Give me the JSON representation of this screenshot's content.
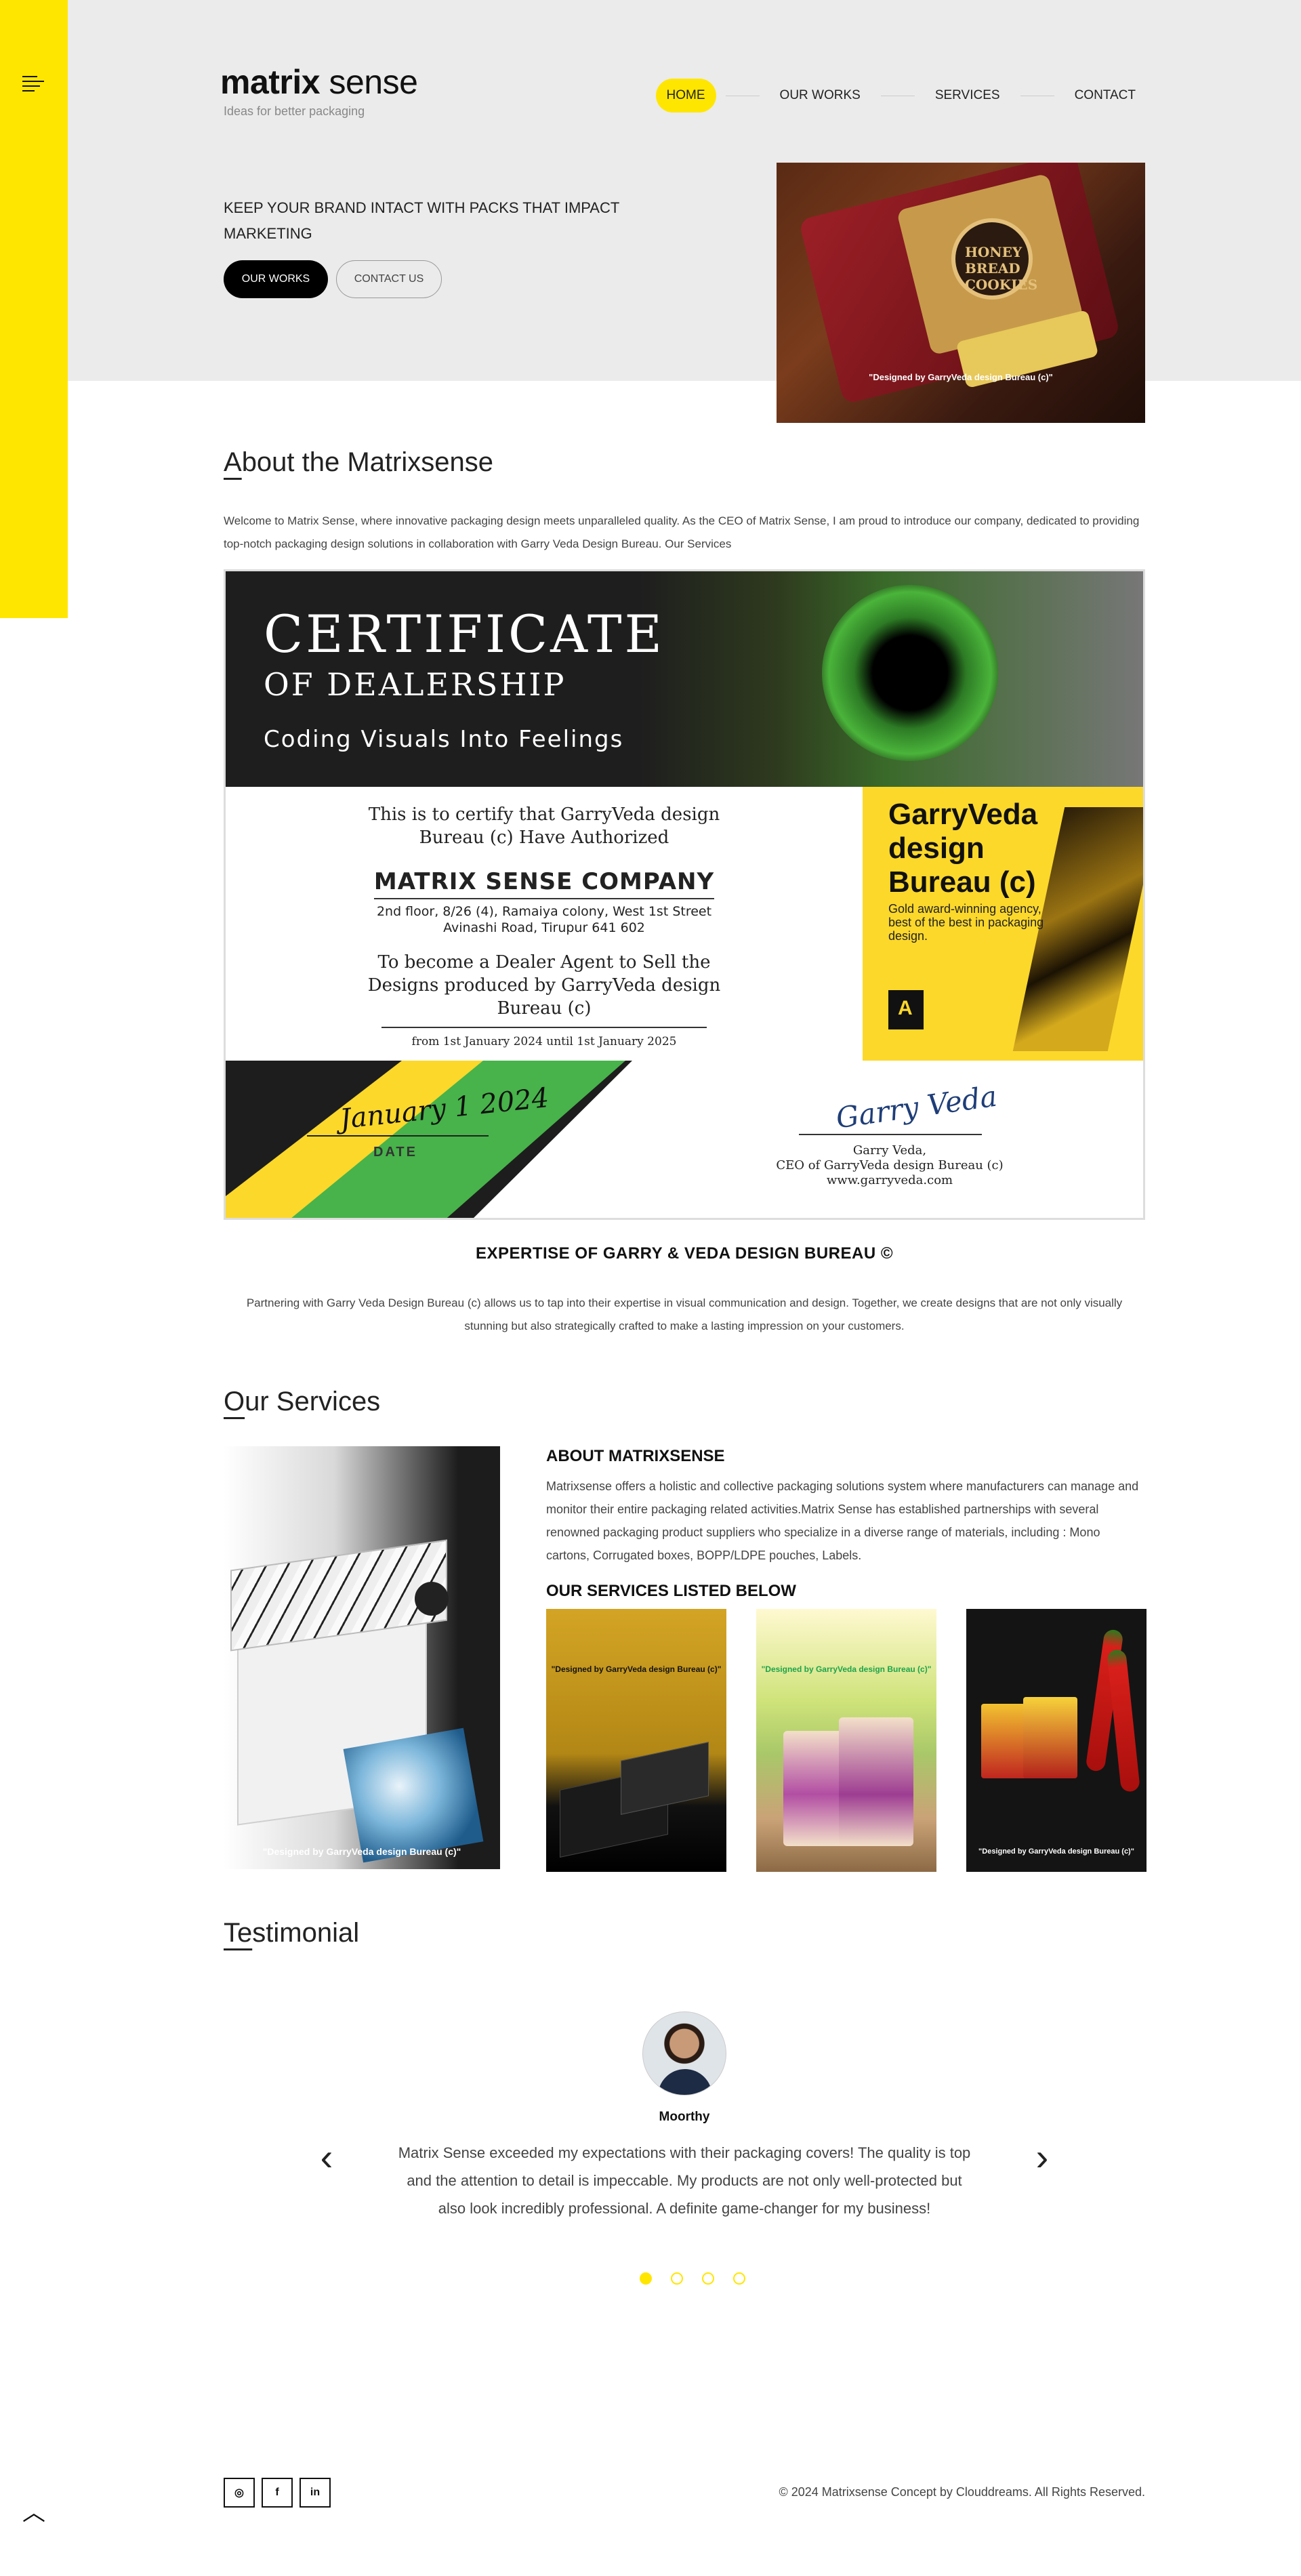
{
  "brand": {
    "name_bold": "matrix",
    "name_light": " sense",
    "tagline": "Ideas for better packaging"
  },
  "nav": {
    "items": [
      {
        "label": "HOME",
        "active": true
      },
      {
        "label": "OUR WORKS",
        "active": false
      },
      {
        "label": "SERVICES",
        "active": false
      },
      {
        "label": "CONTACT",
        "active": false
      }
    ]
  },
  "hero": {
    "headline": "KEEP YOUR BRAND INTACT WITH PACKS THAT IMPACT MARKETING",
    "primary_button": "OUR WORKS",
    "secondary_button": "CONTACT US",
    "image_seal": "HONEY BREAD COOKIES",
    "image_caption": "\"Designed by GarryVeda design Bureau (c)\""
  },
  "about": {
    "title_first": "A",
    "title_rest": "bout the Matrixsense",
    "text": "Welcome to Matrix Sense, where innovative packaging design meets unparalleled quality. As the CEO of Matrix Sense, I am proud to introduce our company, dedicated to providing top-notch packaging design solutions in collaboration with Garry Veda Design Bureau. Our Services"
  },
  "certificate": {
    "title": "CERTIFICATE",
    "subtitle": "OF DEALERSHIP",
    "tagline": "Coding Visuals Into Feelings",
    "certify_line": "This is to certify that GarryVeda design Bureau (c) Have Authorized",
    "company": "MATRIX SENSE COMPANY",
    "address_1": "2nd floor, 8/26 (4), Ramaiya colony, West 1st Street",
    "address_2": "Avinashi Road, Tirupur 641 602",
    "purpose": "To become a Dealer Agent to Sell the Designs produced by GarryVeda design Bureau (c)",
    "validity": "from 1st January 2024 until 1st January 2025",
    "gv_name": "GarryVeda design Bureau (c)",
    "gv_desc": "Gold award-winning agency, best of the best in packaging design.",
    "date_signature": "January 1 2024",
    "date_label": "DATE",
    "signature": "Garry Veda",
    "signer_line_1": "Garry Veda,",
    "signer_line_2": "CEO of GarryVeda design Bureau (c)",
    "signer_line_3": "www.garryveda.com"
  },
  "expertise": {
    "title": "EXPERTISE OF GARRY & VEDA DESIGN BUREAU ©",
    "text": "Partnering with Garry Veda Design Bureau (c) allows us to tap into their expertise in visual communication and design. Together, we create designs that are not only visually stunning but also strategically crafted to make a lasting impression on your customers."
  },
  "services": {
    "title_first": "O",
    "title_rest": "ur Services",
    "main_caption": "\"Designed by GarryVeda design Bureau (c)\"",
    "about_heading": "ABOUT MATRIXSENSE",
    "about_text": "Matrixsense offers a holistic and collective packaging solutions system where manufacturers can manage and monitor their entire packaging related activities.Matrix Sense has established partnerships with several renowned packaging product suppliers who specialize in a diverse range of materials, including : Mono cartons, Corrugated boxes, BOPP/LDPE pouches, Labels.",
    "list_heading": "OUR SERVICES LISTED BELOW",
    "cards": [
      {
        "caption": "\"Designed by GarryVeda design Bureau (c)\""
      },
      {
        "caption": "\"Designed by GarryVeda design Bureau (c)\""
      },
      {
        "caption": "\"Designed by GarryVeda design Bureau (c)\""
      }
    ]
  },
  "testimonial": {
    "title_first": "Te",
    "title_rest": "stimonial",
    "name": "Moorthy",
    "quote": "Matrix Sense exceeded my expectations with their packaging covers! The quality is top and the attention to detail is impeccable. My products are not only well-protected but also look incredibly professional. A definite game-changer for my business!",
    "prev_icon": "‹",
    "next_icon": "›",
    "active_dot": 1,
    "dot_count": 4
  },
  "footer": {
    "socials": [
      {
        "icon": "instagram-icon",
        "glyph": "◎"
      },
      {
        "icon": "facebook-icon",
        "glyph": "f"
      },
      {
        "icon": "linkedin-icon",
        "glyph": "in"
      }
    ],
    "copyright": "© 2024 Matrixsense Concept by Clouddreams. All Rights Reserved.",
    "to_top_glyph": "︿"
  },
  "colors": {
    "accent": "#ffe600",
    "hero_bg": "#ebebeb",
    "dark": "#000000"
  }
}
